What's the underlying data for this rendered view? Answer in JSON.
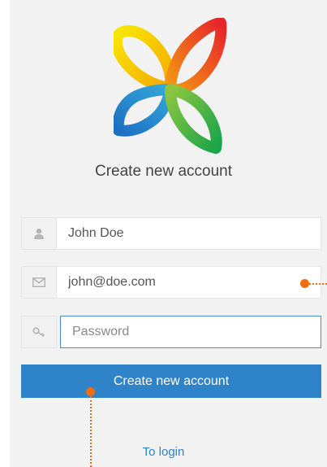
{
  "signup": {
    "title": "Create new account",
    "name_value": "John Doe",
    "email_value": "john@doe.com",
    "password_placeholder": "Password",
    "submit_label": "Create new account",
    "login_link": "To login"
  },
  "icons": {
    "name": "user-icon",
    "email": "envelope-icon",
    "password": "key-icon"
  },
  "colors": {
    "primary": "#2f83c9",
    "annotation": "#ef6d10",
    "focus_border": "#4a8ccd"
  }
}
